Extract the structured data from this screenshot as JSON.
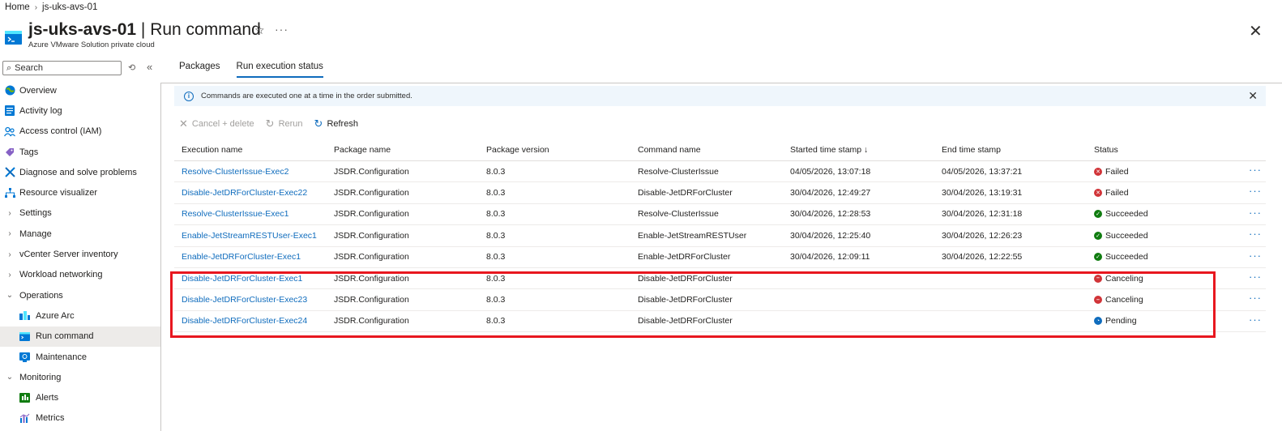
{
  "breadcrumb": {
    "home": "Home",
    "current": "js-uks-avs-01"
  },
  "header": {
    "title_bold": "js-uks-avs-01",
    "title_rest": " | Run command",
    "subtitle": "Azure VMware Solution private cloud"
  },
  "search": {
    "placeholder": "Search"
  },
  "sidebar": {
    "items": [
      {
        "label": "Overview",
        "icon": "globe-icon"
      },
      {
        "label": "Activity log",
        "icon": "log-icon"
      },
      {
        "label": "Access control (IAM)",
        "icon": "people-icon"
      },
      {
        "label": "Tags",
        "icon": "tag-icon"
      },
      {
        "label": "Diagnose and solve problems",
        "icon": "wrench-icon"
      },
      {
        "label": "Resource visualizer",
        "icon": "network-icon"
      },
      {
        "label": "Settings",
        "icon": "chevron-right-icon"
      },
      {
        "label": "Manage",
        "icon": "chevron-right-icon"
      },
      {
        "label": "vCenter Server inventory",
        "icon": "chevron-right-icon"
      },
      {
        "label": "Workload networking",
        "icon": "chevron-right-icon"
      },
      {
        "label": "Operations",
        "icon": "chevron-down-icon"
      },
      {
        "label": "Azure Arc",
        "icon": "arc-icon"
      },
      {
        "label": "Run command",
        "icon": "terminal-icon"
      },
      {
        "label": "Maintenance",
        "icon": "maintenance-icon"
      },
      {
        "label": "Monitoring",
        "icon": "chevron-down-icon"
      },
      {
        "label": "Alerts",
        "icon": "alerts-icon"
      },
      {
        "label": "Metrics",
        "icon": "metrics-icon"
      }
    ]
  },
  "tabs": {
    "packages": "Packages",
    "status": "Run execution status"
  },
  "info": {
    "message": "Commands are executed one at a time in the order submitted."
  },
  "toolbar": {
    "cancel": "Cancel + delete",
    "rerun": "Rerun",
    "refresh": "Refresh"
  },
  "table": {
    "headers": [
      "Execution name",
      "Package name",
      "Package version",
      "Command name",
      "Started time stamp ↓",
      "End time stamp",
      "Status"
    ],
    "rows": [
      {
        "exec": "Resolve-ClusterIssue-Exec2",
        "pkg": "JSDR.Configuration",
        "ver": "8.0.3",
        "cmd": "Resolve-ClusterIssue",
        "start": "04/05/2026, 13:07:18",
        "end": "04/05/2026, 13:37:21",
        "status": "Failed"
      },
      {
        "exec": "Disable-JetDRForCluster-Exec22",
        "pkg": "JSDR.Configuration",
        "ver": "8.0.3",
        "cmd": "Disable-JetDRForCluster",
        "start": "30/04/2026, 12:49:27",
        "end": "30/04/2026, 13:19:31",
        "status": "Failed"
      },
      {
        "exec": "Resolve-ClusterIssue-Exec1",
        "pkg": "JSDR.Configuration",
        "ver": "8.0.3",
        "cmd": "Resolve-ClusterIssue",
        "start": "30/04/2026, 12:28:53",
        "end": "30/04/2026, 12:31:18",
        "status": "Succeeded"
      },
      {
        "exec": "Enable-JetStreamRESTUser-Exec1",
        "pkg": "JSDR.Configuration",
        "ver": "8.0.3",
        "cmd": "Enable-JetStreamRESTUser",
        "start": "30/04/2026, 12:25:40",
        "end": "30/04/2026, 12:26:23",
        "status": "Succeeded"
      },
      {
        "exec": "Enable-JetDRForCluster-Exec1",
        "pkg": "JSDR.Configuration",
        "ver": "8.0.3",
        "cmd": "Enable-JetDRForCluster",
        "start": "30/04/2026, 12:09:11",
        "end": "30/04/2026, 12:22:55",
        "status": "Succeeded"
      },
      {
        "exec": "Disable-JetDRForCluster-Exec1",
        "pkg": "JSDR.Configuration",
        "ver": "8.0.3",
        "cmd": "Disable-JetDRForCluster",
        "start": "",
        "end": "",
        "status": "Canceling"
      },
      {
        "exec": "Disable-JetDRForCluster-Exec23",
        "pkg": "JSDR.Configuration",
        "ver": "8.0.3",
        "cmd": "Disable-JetDRForCluster",
        "start": "",
        "end": "",
        "status": "Canceling"
      },
      {
        "exec": "Disable-JetDRForCluster-Exec24",
        "pkg": "JSDR.Configuration",
        "ver": "8.0.3",
        "cmd": "Disable-JetDRForCluster",
        "start": "",
        "end": "",
        "status": "Pending"
      }
    ]
  },
  "colors": {
    "accent": "#0f6cbd",
    "highlight": "#e8171f",
    "failed": "#d13438",
    "succeeded": "#107c10"
  }
}
